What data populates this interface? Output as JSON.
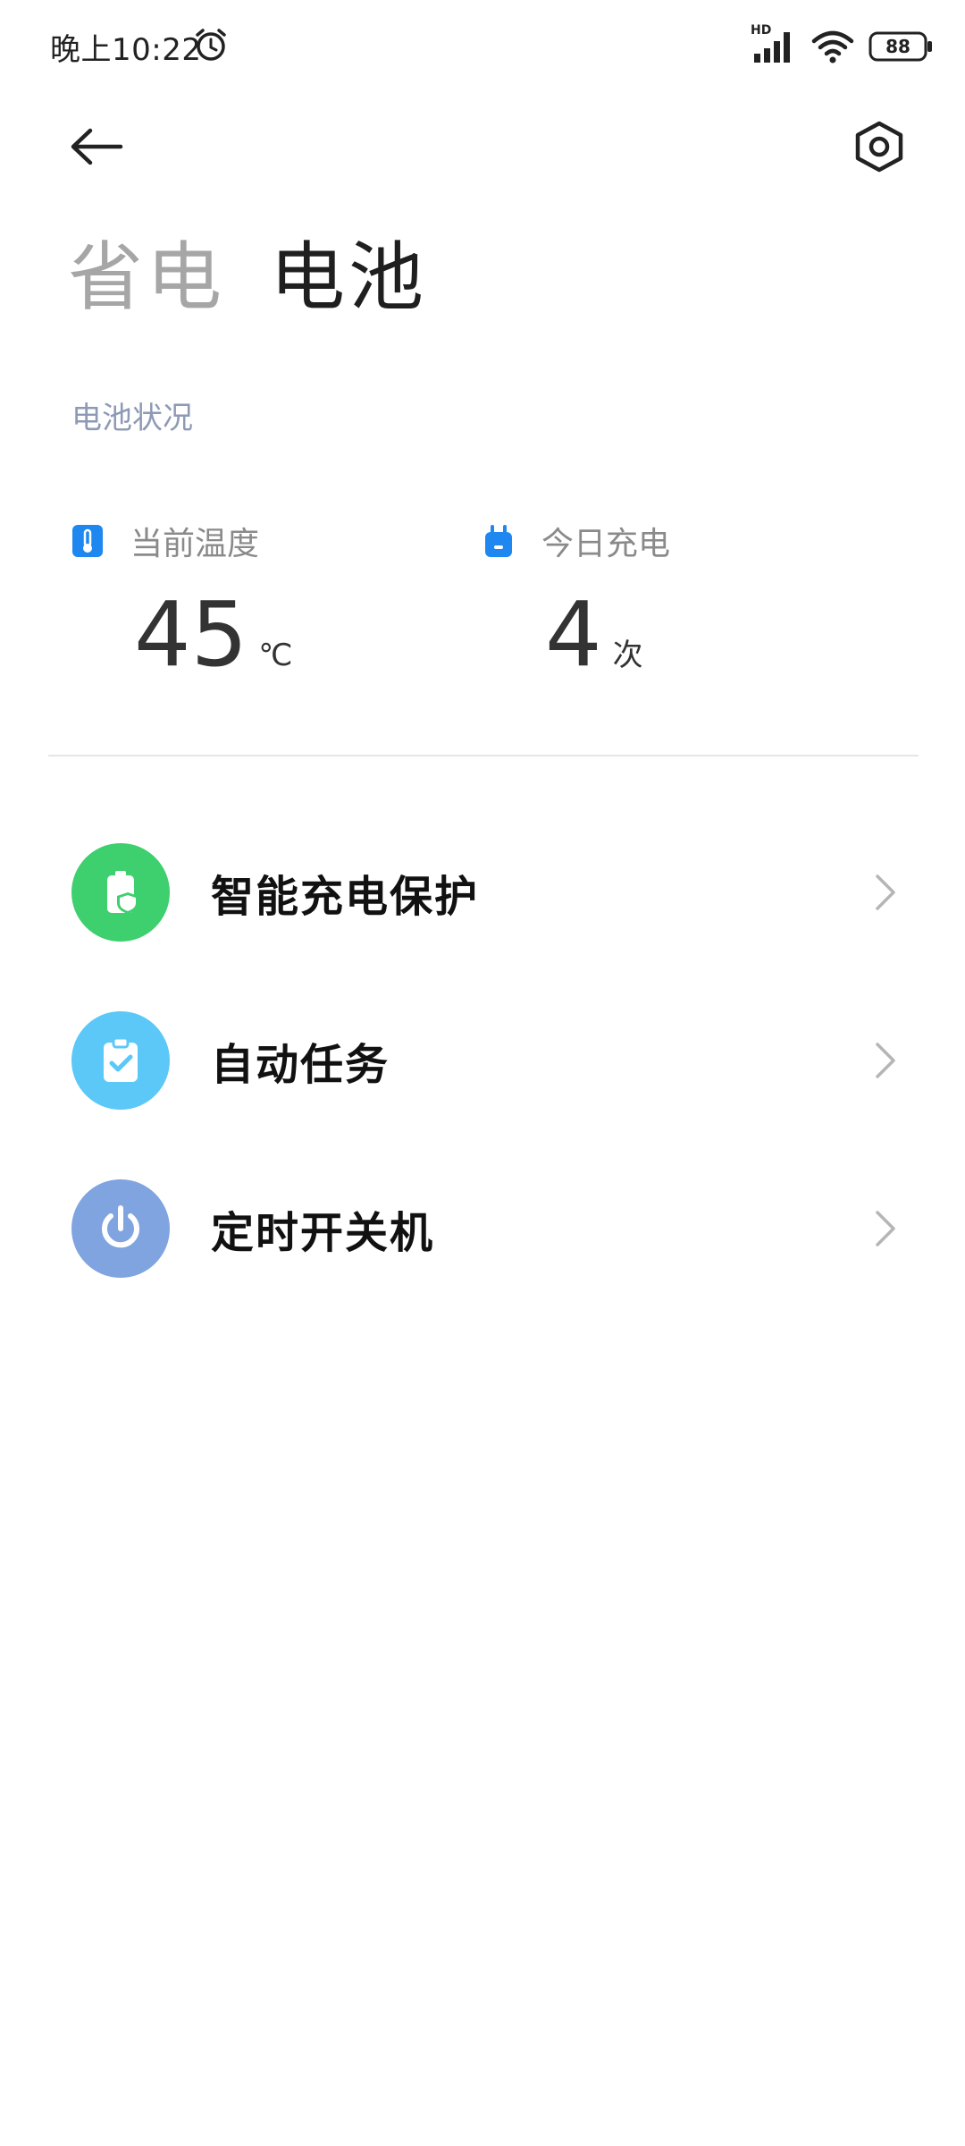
{
  "status_bar": {
    "time": "晚上10:22",
    "network_badge": "HD",
    "battery_level": "88",
    "icons": [
      "alarm-icon",
      "signal-icon",
      "wifi-icon",
      "battery-icon"
    ]
  },
  "app_bar": {
    "back_icon": "arrow-left-icon",
    "settings_icon": "hexagon-settings-icon"
  },
  "tabs": [
    {
      "label": "省电",
      "active": false
    },
    {
      "label": "电池",
      "active": true
    }
  ],
  "battery_status": {
    "section_label": "电池状况",
    "temperature": {
      "label": "当前温度",
      "value": "45",
      "unit": "℃",
      "icon": "thermometer-icon",
      "icon_color": "#1e88f0"
    },
    "charges_today": {
      "label": "今日充电",
      "value": "4",
      "unit": "次",
      "icon": "plug-icon",
      "icon_color": "#1e88f0"
    }
  },
  "menu": [
    {
      "label": "智能充电保护",
      "icon": "battery-shield-icon",
      "color": "#3ecf6e"
    },
    {
      "label": "自动任务",
      "icon": "clipboard-check-icon",
      "color": "#5bc8f7"
    },
    {
      "label": "定时开关机",
      "icon": "power-icon",
      "color": "#7fa4e0"
    }
  ]
}
